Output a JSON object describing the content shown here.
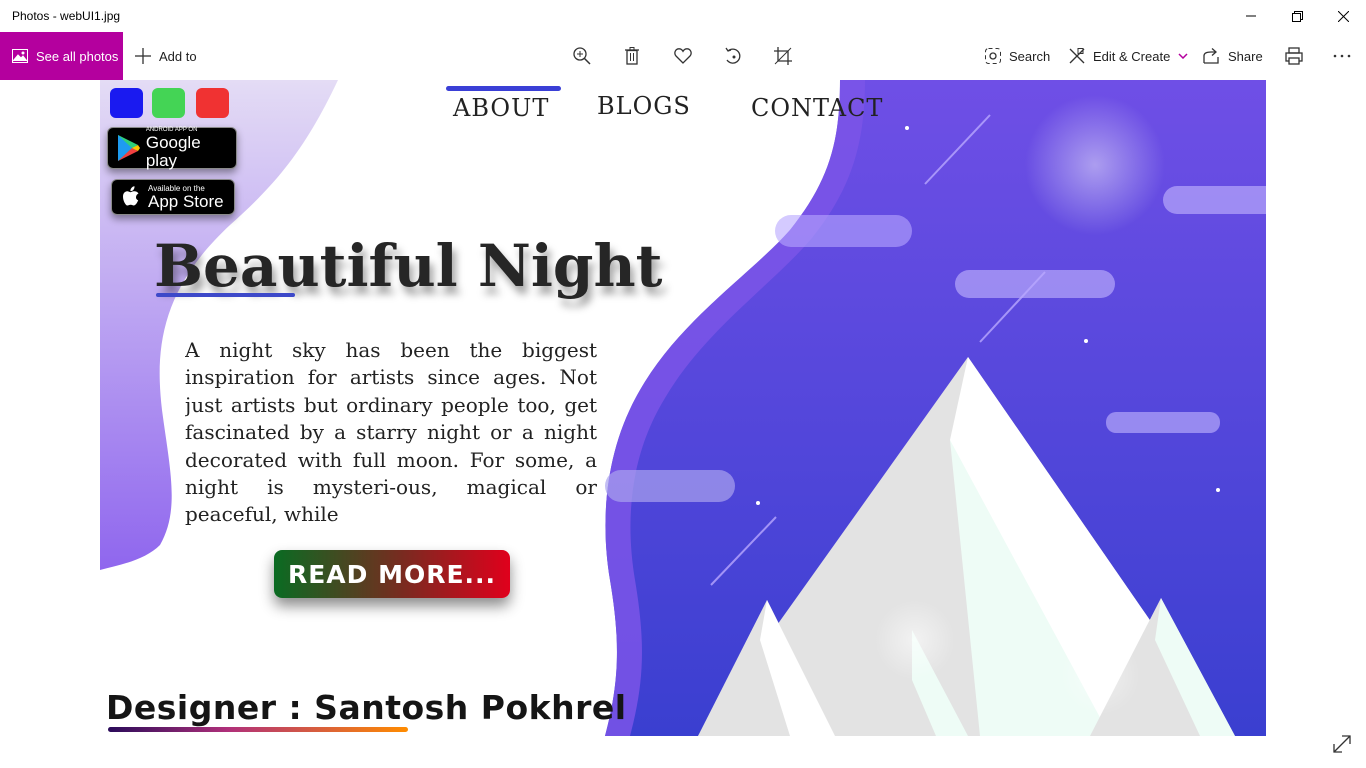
{
  "window": {
    "title": "Photos - webUI1.jpg"
  },
  "toolbar": {
    "see_all_label": "See all photos",
    "add_to_label": "Add to",
    "search_label": "Search",
    "edit_create_label": "Edit & Create",
    "share_label": "Share",
    "accent_color": "#b4009e"
  },
  "image": {
    "nav": {
      "about": "ABOUT",
      "blogs": "BLOGS",
      "contact": "CONTACT",
      "active": "ABOUT"
    },
    "color_swatches": [
      "#1a1af0",
      "#44d455",
      "#f03232"
    ],
    "google_play": {
      "small": "ANDROID APP ON",
      "big": "Google play"
    },
    "app_store": {
      "small": "Available on the",
      "big": "App Store"
    },
    "heading": "Beautiful Night",
    "paragraph": "A night sky has been the biggest inspiration for artists since ages. Not just artists but ordinary people too, get fascinated by a starry night or a night decorated with full moon. For some, a night is mysteri-ous, magical or peaceful, while",
    "read_more": "READ MORE...",
    "designer": "Designer : Santosh Pokhrel"
  }
}
